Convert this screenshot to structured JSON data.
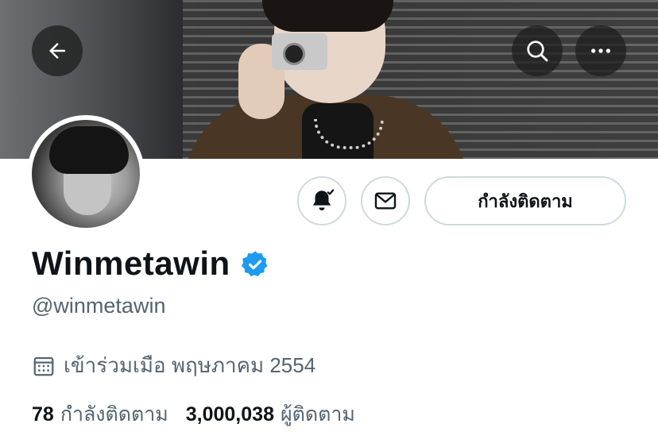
{
  "header": {
    "back_icon": "arrow-left-icon",
    "search_icon": "search-icon",
    "more_icon": "more-horizontal-icon"
  },
  "profile": {
    "display_name": "Winmetawin",
    "verified": true,
    "handle": "@winmetawin",
    "joined": "เข้าร่วมเมือ พฤษภาคม 2554"
  },
  "actions": {
    "notifications_icon": "bell-check-icon",
    "message_icon": "mail-icon",
    "follow_label": "กำลังติดตาม"
  },
  "stats": {
    "following_count": "78",
    "following_label": "กำลังติดตาม",
    "followers_count": "3,000,038",
    "followers_label": "ผู้ติดตาม"
  },
  "colors": {
    "verified": "#1d9bf0",
    "text_primary": "#0f1419",
    "text_secondary": "#536471",
    "border": "#cfd9de"
  }
}
